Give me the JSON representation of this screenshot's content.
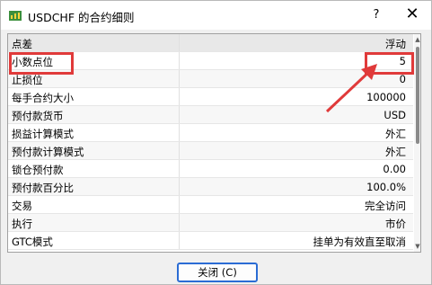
{
  "window": {
    "title": "USDCHF 的合约细则"
  },
  "titlebar": {
    "help_label": "?",
    "close_label": "✕"
  },
  "icons": {
    "app": "chart-window-icon"
  },
  "rows": [
    {
      "label": "点差",
      "value": "浮动"
    },
    {
      "label": "小数点位",
      "value": "5"
    },
    {
      "label": "止损位",
      "value": "0"
    },
    {
      "label": "每手合约大小",
      "value": "100000"
    },
    {
      "label": "预付款货币",
      "value": "USD"
    },
    {
      "label": "损益计算模式",
      "value": "外汇"
    },
    {
      "label": "预付款计算模式",
      "value": "外汇"
    },
    {
      "label": "锁仓预付款",
      "value": "0.00"
    },
    {
      "label": "预付款百分比",
      "value": "100.0%"
    },
    {
      "label": "交易",
      "value": "完全访问"
    },
    {
      "label": "执行",
      "value": "市价"
    },
    {
      "label": "GTC模式",
      "value": "挂单为有效直至取消"
    }
  ],
  "footer": {
    "close_button": "关闭 (C)"
  },
  "colors": {
    "highlight": "#e03a3a",
    "button_border": "#2b6cd4"
  }
}
